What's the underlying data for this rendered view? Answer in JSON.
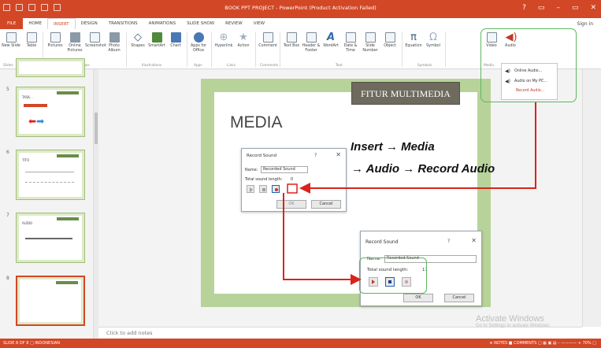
{
  "window": {
    "title": "BOOK PPT PROJECT - PowerPoint (Product Activation Failed)",
    "signin": "Sign in",
    "controls": [
      "?",
      "▭",
      "–",
      "▭",
      "✕"
    ]
  },
  "tabs": [
    "FILE",
    "HOME",
    "INSERT",
    "DESIGN",
    "TRANSITIONS",
    "ANIMATIONS",
    "SLIDE SHOW",
    "REVIEW",
    "VIEW"
  ],
  "ribbon": {
    "buttons": [
      {
        "label": "New Slide",
        "icon": "new-slide-icon"
      },
      {
        "label": "Table",
        "icon": "table-icon"
      },
      {
        "label": "Pictures",
        "icon": "pictures-icon"
      },
      {
        "label": "Online Pictures",
        "icon": "online-pictures-icon"
      },
      {
        "label": "Screenshot",
        "icon": "screenshot-icon"
      },
      {
        "label": "Photo Album",
        "icon": "photo-album-icon"
      },
      {
        "label": "Shapes",
        "icon": "shapes-icon"
      },
      {
        "label": "SmartArt",
        "icon": "smartart-icon"
      },
      {
        "label": "Chart",
        "icon": "chart-icon"
      },
      {
        "label": "Apps for Office",
        "icon": "apps-icon"
      },
      {
        "label": "Hyperlink",
        "icon": "hyperlink-icon"
      },
      {
        "label": "Action",
        "icon": "action-icon"
      },
      {
        "label": "Comment",
        "icon": "comment-icon"
      },
      {
        "label": "Text Box",
        "icon": "text-box-icon"
      },
      {
        "label": "Header & Footer",
        "icon": "header-footer-icon"
      },
      {
        "label": "WordArt",
        "icon": "wordart-icon"
      },
      {
        "label": "Date & Time",
        "icon": "date-time-icon"
      },
      {
        "label": "Slide Number",
        "icon": "slide-number-icon"
      },
      {
        "label": "Object",
        "icon": "object-icon"
      },
      {
        "label": "Equation",
        "icon": "equation-icon"
      },
      {
        "label": "Symbol",
        "icon": "symbol-icon"
      },
      {
        "label": "Video",
        "icon": "video-icon"
      },
      {
        "label": "Audio",
        "icon": "audio-icon"
      }
    ],
    "groups": [
      "Slides",
      "Tables",
      "Images",
      "Illustrations",
      "Apps",
      "Links",
      "Comments",
      "Text",
      "Symbols",
      "Media"
    ]
  },
  "audio_menu": [
    "Online Audio...",
    "Audio on My PC...",
    "Record Audio..."
  ],
  "slides": [
    {
      "num": "5",
      "title": "TASK..."
    },
    {
      "num": "6",
      "title": "TITO"
    },
    {
      "num": "7",
      "title": "AUDIO"
    },
    {
      "num": "8",
      "title": ""
    }
  ],
  "slide": {
    "tag": "FITUR MULTIMEDIA",
    "title": "MEDIA"
  },
  "dialog1": {
    "title": "Record Sound",
    "help": "?",
    "name_label": "Name:",
    "name_value": "Recorded Sound",
    "length_label": "Total sound length:",
    "length_value": "0",
    "ok": "OK",
    "cancel": "Cancel"
  },
  "dialog2": {
    "title": "Record Sound",
    "help": "?",
    "name_label": "Name:",
    "name_value": "Recorded Sound",
    "length_label": "Total sound length:",
    "length_value": "11",
    "ok": "OK",
    "cancel": "Cancel"
  },
  "annotation": {
    "line1": "Insert → Media",
    "line2": "→ Audio → Record Audio"
  },
  "notes_placeholder": "Click to add notes",
  "status": {
    "left": "SLIDE 8 OF 8   □   INDONESIAN",
    "right": "≡ NOTES   ■ COMMENTS   □  ▦  ▣  ▤   – ———— + 70%  □"
  },
  "watermark": {
    "line1": "Activate Windows",
    "line2": "Go to Settings to activate Windows."
  },
  "colors": {
    "accent": "#d24726",
    "highlight": "#5cb85c",
    "arrow": "#d9241b",
    "slide_bg": "#b8d39a"
  }
}
